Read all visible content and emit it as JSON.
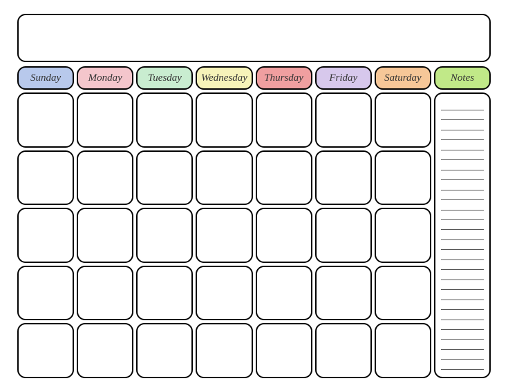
{
  "days": [
    {
      "label": "Sunday",
      "color": "#b8c9ec"
    },
    {
      "label": "Monday",
      "color": "#f4c6cc"
    },
    {
      "label": "Tuesday",
      "color": "#c9edd0"
    },
    {
      "label": "Wednesday",
      "color": "#f6f3b9"
    },
    {
      "label": "Thursday",
      "color": "#f09fa0"
    },
    {
      "label": "Friday",
      "color": "#d7c8ec"
    },
    {
      "label": "Saturday",
      "color": "#f6c798"
    }
  ],
  "notes": {
    "label": "Notes",
    "color": "#c1e988",
    "lineCount": 27
  },
  "rowsPerDay": 5
}
